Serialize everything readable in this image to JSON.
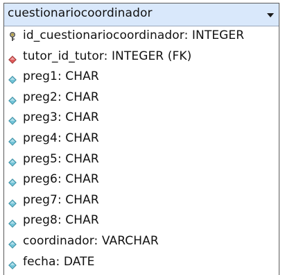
{
  "entity": {
    "title": "cuestionariocoordinador",
    "columns": [
      {
        "label": "id_cuestionariocoordinador: INTEGER",
        "icon": "primary-key-icon"
      },
      {
        "label": "tutor_id_tutor: INTEGER (FK)",
        "icon": "foreign-key-icon"
      },
      {
        "label": "preg1: CHAR",
        "icon": "column-icon"
      },
      {
        "label": "preg2: CHAR",
        "icon": "column-icon"
      },
      {
        "label": "preg3: CHAR",
        "icon": "column-icon"
      },
      {
        "label": "preg4: CHAR",
        "icon": "column-icon"
      },
      {
        "label": "preg5: CHAR",
        "icon": "column-icon"
      },
      {
        "label": "preg6: CHAR",
        "icon": "column-icon"
      },
      {
        "label": "preg7: CHAR",
        "icon": "column-icon"
      },
      {
        "label": "preg8: CHAR",
        "icon": "column-icon"
      },
      {
        "label": "coordinador: VARCHAR",
        "icon": "column-icon"
      },
      {
        "label": "fecha: DATE",
        "icon": "column-icon"
      }
    ]
  },
  "colors": {
    "header_bg": "#d9e8fb",
    "column_icon": "#72c4d8",
    "foreign_key_icon": "#e05a5a",
    "primary_key_icon": "#b8a44a"
  }
}
